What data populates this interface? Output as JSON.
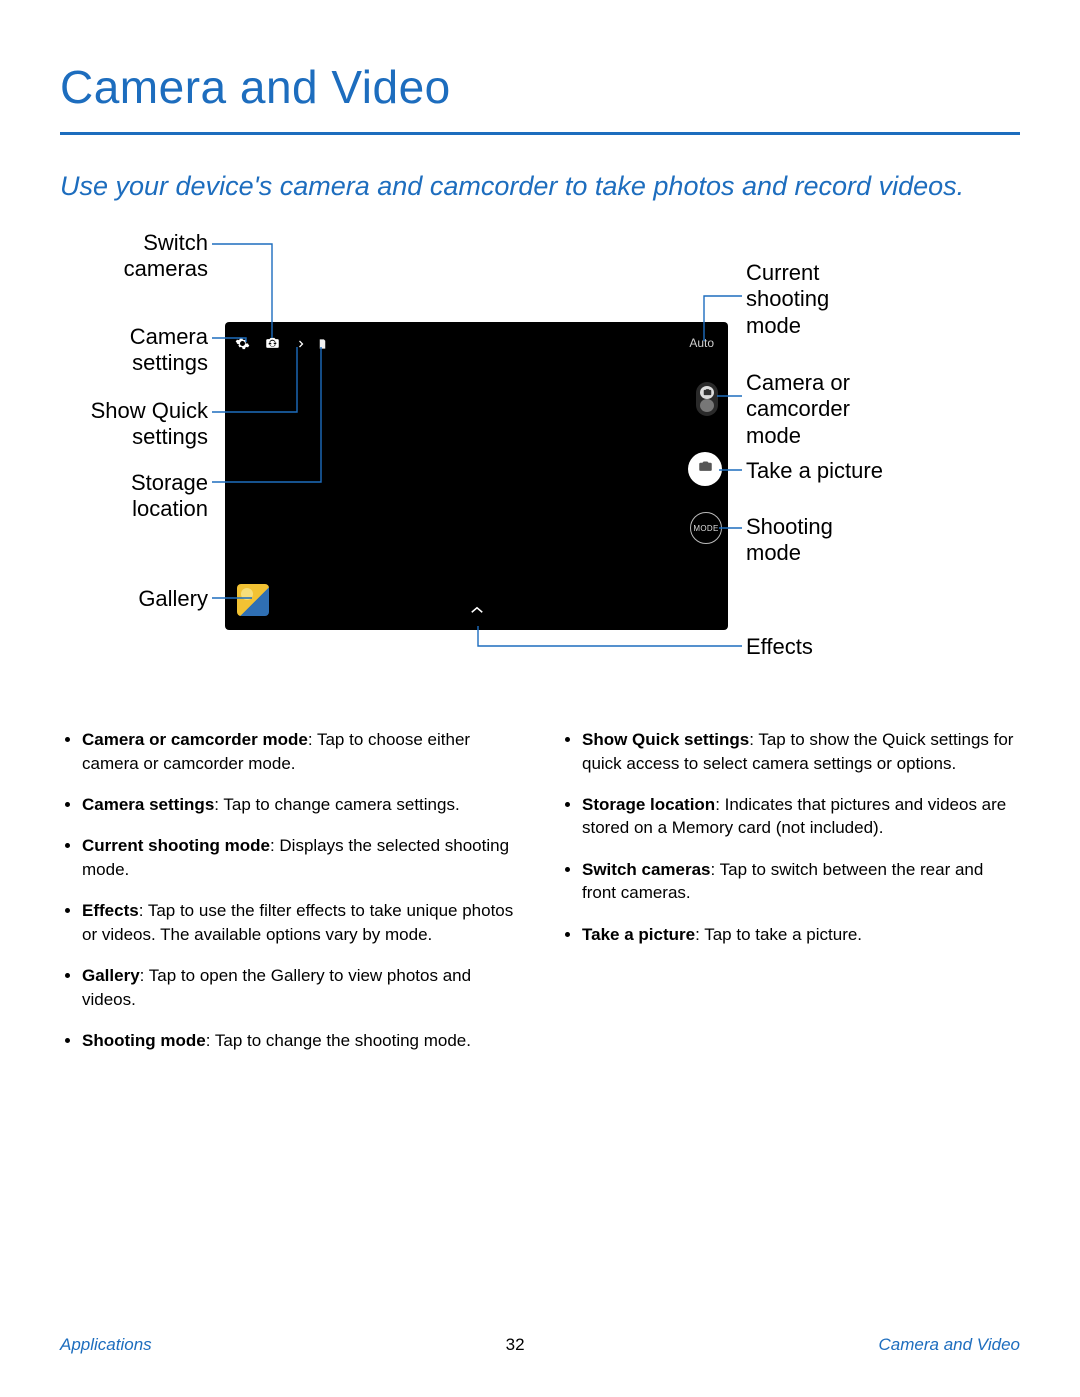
{
  "title": "Camera and Video",
  "intro": "Use your device's camera and camcorder to take photos and record videos.",
  "callouts": {
    "left": {
      "switch_cameras": "Switch\ncameras",
      "camera_settings": "Camera\nsettings",
      "show_quick_settings": "Show Quick\nsettings",
      "storage_location": "Storage\nlocation",
      "gallery": "Gallery"
    },
    "right": {
      "current_shooting_mode": "Current\nshooting\nmode",
      "camera_or_camcorder": "Camera or\ncamcorder\nmode",
      "take_a_picture": "Take a picture",
      "shooting_mode": "Shooting\nmode",
      "effects": "Effects"
    }
  },
  "phone": {
    "auto_label": "Auto",
    "mode_label": "MODE"
  },
  "bullets": {
    "left": [
      {
        "term": "Camera or camcorder mode",
        "desc": ": Tap to choose either camera or camcorder mode."
      },
      {
        "term": "Camera settings",
        "desc": ": Tap to change camera settings."
      },
      {
        "term": "Current shooting mode",
        "desc": ": Displays the selected shooting mode."
      },
      {
        "term": "Effects",
        "desc": ": Tap to use the filter effects to take unique photos or videos. The available options vary by mode."
      },
      {
        "term": "Gallery",
        "desc": ": Tap to open the Gallery to view photos and videos."
      },
      {
        "term": "Shooting mode",
        "desc": ": Tap to change the shooting mode."
      }
    ],
    "right": [
      {
        "term": "Show Quick settings",
        "desc": ": Tap to show the Quick settings for quick access to select camera settings or options."
      },
      {
        "term": "Storage location",
        "desc": ": Indicates that pictures and videos are stored on a Memory card (not included)."
      },
      {
        "term": "Switch cameras",
        "desc": ": Tap to switch between the rear and front cameras."
      },
      {
        "term": "Take a picture",
        "desc": ": Tap to take a picture."
      }
    ]
  },
  "footer": {
    "left": "Applications",
    "page": "32",
    "right": "Camera and Video"
  }
}
